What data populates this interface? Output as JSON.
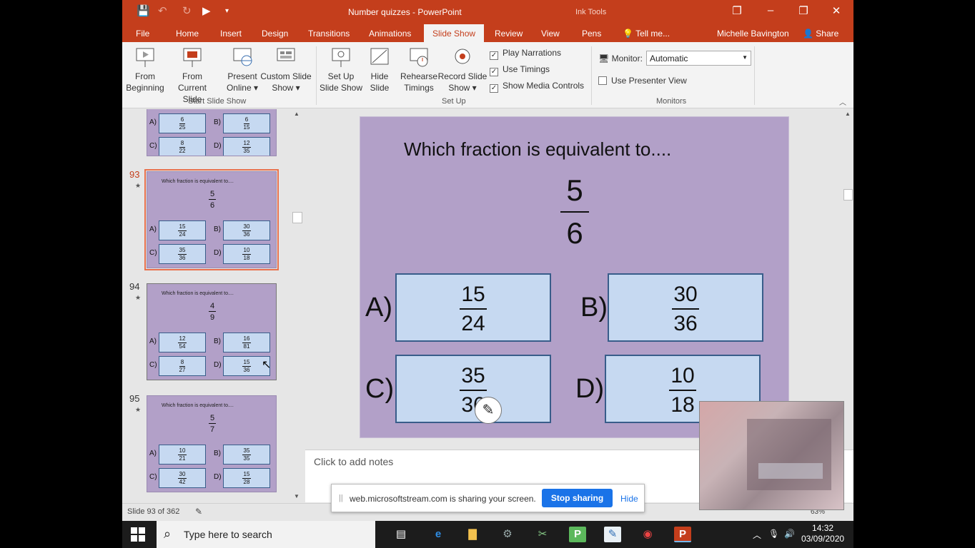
{
  "window": {
    "title": "Number quizzes - PowerPoint",
    "context_tab": "Ink Tools"
  },
  "tabs": [
    "File",
    "Home",
    "Insert",
    "Design",
    "Transitions",
    "Animations",
    "Slide Show",
    "Review",
    "View",
    "Pens",
    "Tell me..."
  ],
  "active_tab": "Slide Show",
  "user": "Michelle Bavington",
  "share_label": "Share",
  "ribbon": {
    "from_beginning": [
      "From",
      "Beginning"
    ],
    "from_current": [
      "From",
      "Current Slide"
    ],
    "present_online": [
      "Present",
      "Online ▾"
    ],
    "custom_show": [
      "Custom Slide",
      "Show ▾"
    ],
    "group_start": "Start Slide Show",
    "setup_show": [
      "Set Up",
      "Slide Show"
    ],
    "hide_slide": [
      "Hide",
      "Slide"
    ],
    "rehearse": [
      "Rehearse",
      "Timings"
    ],
    "record": [
      "Record Slide",
      "Show ▾"
    ],
    "play_narrations": "Play Narrations",
    "use_timings": "Use Timings",
    "show_media": "Show Media Controls",
    "group_setup": "Set Up",
    "monitor_label": "Monitor:",
    "monitor_value": "Automatic",
    "presenter_view": "Use Presenter View",
    "group_monitors": "Monitors"
  },
  "thumbnails": [
    {
      "num": "",
      "question": "",
      "fraction": [
        "",
        ""
      ],
      "answers": [
        [
          "6",
          "25"
        ],
        [
          "6",
          "15"
        ],
        [
          "8",
          "22"
        ],
        [
          "12",
          "35"
        ]
      ],
      "partial": true
    },
    {
      "num": "93",
      "question": "Which fraction is equivalent to....",
      "fraction": [
        "5",
        "6"
      ],
      "answers": [
        [
          "15",
          "24"
        ],
        [
          "30",
          "36"
        ],
        [
          "35",
          "36"
        ],
        [
          "10",
          "18"
        ]
      ],
      "selected": true
    },
    {
      "num": "94",
      "question": "Which fraction is equivalent to....",
      "fraction": [
        "4",
        "9"
      ],
      "answers": [
        [
          "12",
          "54"
        ],
        [
          "16",
          "81"
        ],
        [
          "8",
          "27"
        ],
        [
          "15",
          "36"
        ]
      ]
    },
    {
      "num": "95",
      "question": "Which fraction is equivalent to....",
      "fraction": [
        "5",
        "7"
      ],
      "answers": [
        [
          "10",
          "21"
        ],
        [
          "35",
          "35"
        ],
        [
          "30",
          "42"
        ],
        [
          "15",
          "28"
        ]
      ]
    }
  ],
  "answer_letters": [
    "A)",
    "B)",
    "C)",
    "D)"
  ],
  "slide": {
    "question": "Which fraction is equivalent to....",
    "numerator": "5",
    "denominator": "6",
    "answers": [
      {
        "letter": "A)",
        "num": "15",
        "den": "24"
      },
      {
        "letter": "B)",
        "num": "30",
        "den": "36"
      },
      {
        "letter": "C)",
        "num": "35",
        "den": "36"
      },
      {
        "letter": "D)",
        "num": "10",
        "den": "18"
      }
    ]
  },
  "notes_placeholder": "Click to add notes",
  "status": {
    "slide_info": "Slide 93 of 362",
    "zoom": "63%"
  },
  "share_banner": {
    "message": "web.microsoftstream.com is sharing your screen.",
    "stop": "Stop sharing",
    "hide": "Hide"
  },
  "taskbar": {
    "search_placeholder": "Type here to search",
    "time": "14:32",
    "date": "03/09/2020"
  },
  "colors": {
    "accent": "#c43e1c",
    "slide_bg": "#b2a0c8",
    "answer_box": "#c6d9f1"
  }
}
